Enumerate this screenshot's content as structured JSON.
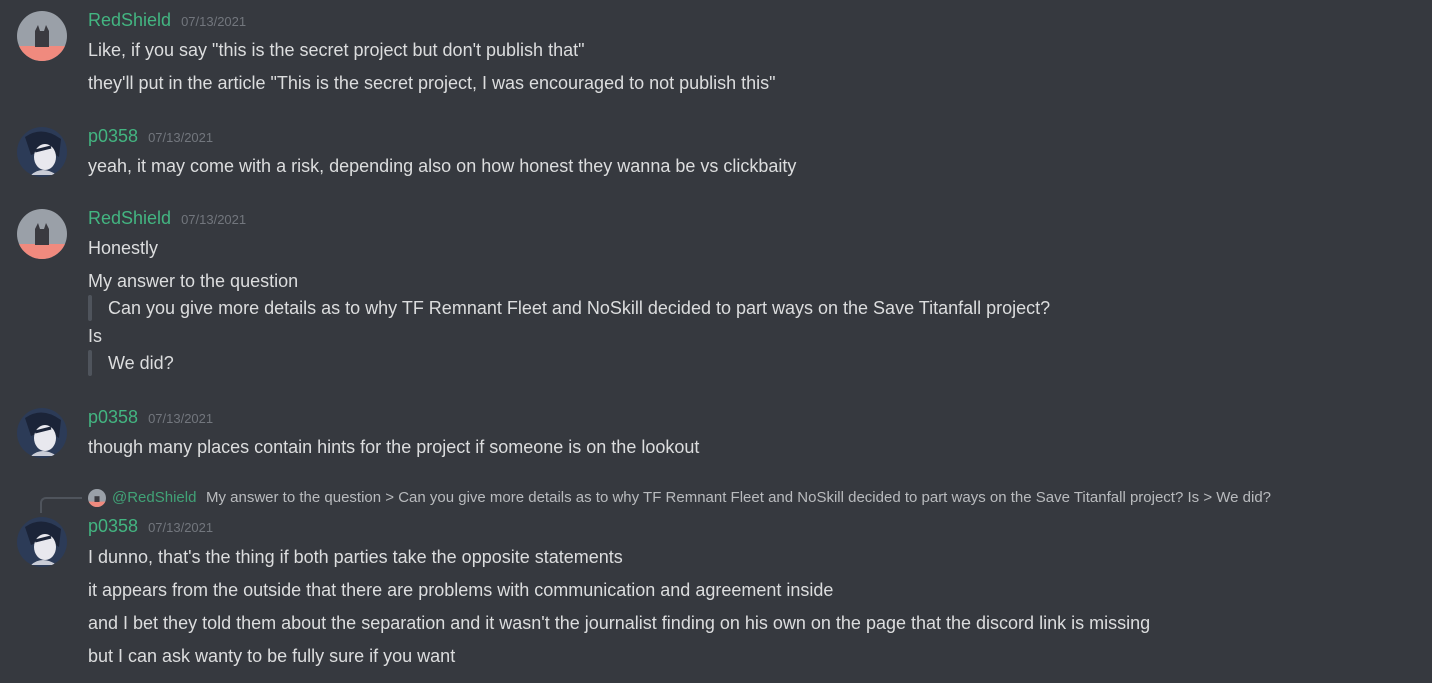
{
  "colors": {
    "background": "#36393f",
    "username": "#43b581",
    "timestamp": "#72767d",
    "text": "#dcddde",
    "quote_bar": "#4f545c"
  },
  "messages": [
    {
      "author": "RedShield",
      "timestamp": "07/13/2021",
      "avatar": "redshield-avatar-icon",
      "lines": [
        "Like, if you say \"this is the secret project but don't publish that\"",
        "they'll put in the article \"This is the secret project, I was encouraged to not publish this\""
      ]
    },
    {
      "author": "p0358",
      "timestamp": "07/13/2021",
      "avatar": "p0358-avatar-icon",
      "lines": [
        "yeah, it may come with a risk, depending also on how honest they wanna be vs clickbaity"
      ]
    },
    {
      "author": "RedShield",
      "timestamp": "07/13/2021",
      "avatar": "redshield-avatar-icon",
      "lines": [
        "Honestly",
        "My answer to the question"
      ],
      "quote1": "Can you give more details as to why TF Remnant Fleet and NoSkill decided to part ways on the Save Titanfall project?",
      "mid_line": "Is",
      "quote2": "We did?"
    },
    {
      "author": "p0358",
      "timestamp": "07/13/2021",
      "avatar": "p0358-avatar-icon",
      "lines": [
        "though many places contain hints for the project if someone is on the lookout"
      ]
    },
    {
      "reply": {
        "mention": "@RedShield",
        "preview": "My answer to the question > Can you give more details as to why TF Remnant Fleet and NoSkill decided to part ways on the Save Titanfall project? Is > We did?"
      },
      "author": "p0358",
      "timestamp": "07/13/2021",
      "avatar": "p0358-avatar-icon",
      "lines": [
        "I dunno, that's the thing if both parties take the opposite statements",
        "it appears from the outside that there are problems with communication and agreement inside",
        "and I bet they told them about the separation and it wasn't the journalist finding on his own on the page that the discord link is missing",
        "but I can ask wanty to be fully sure if you want"
      ]
    }
  ]
}
